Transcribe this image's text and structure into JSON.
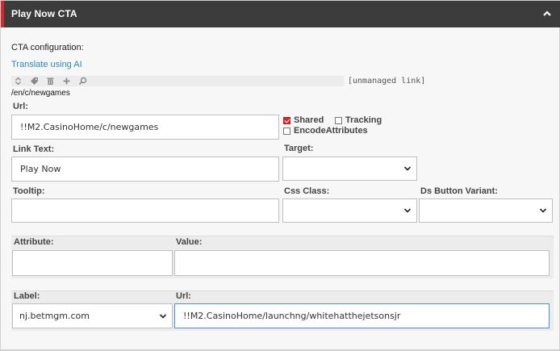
{
  "header": {
    "title": "Play Now CTA",
    "collapse_icon": "chevron-up-icon"
  },
  "cta_configuration_label": "CTA configuration:",
  "translate_link": "Translate using AI",
  "toolbar": {
    "icons": [
      "sort-icon",
      "tag-icon",
      "trash-icon",
      "add-icon",
      "search-icon"
    ],
    "unmanaged_label": "[unmanaged link]",
    "path": "/en/c/newgames"
  },
  "url": {
    "label": "Url:",
    "value": "!!M2.CasinoHome/c/newgames"
  },
  "options": {
    "shared": {
      "label": "Shared",
      "checked": true
    },
    "tracking": {
      "label": "Tracking",
      "checked": false
    },
    "encode_attributes": {
      "label": "EncodeAttributes",
      "checked": false
    }
  },
  "link_text": {
    "label": "Link Text:",
    "value": "Play Now"
  },
  "target": {
    "label": "Target:",
    "value": ""
  },
  "tooltip": {
    "label": "Tooltip:",
    "value": ""
  },
  "css_class": {
    "label": "Css Class:",
    "value": ""
  },
  "ds_button_variant": {
    "label": "Ds Button Variant:",
    "value": ""
  },
  "attributes": {
    "attribute_label": "Attribute:",
    "value_label": "Value:",
    "attribute_value": "",
    "value_value": ""
  },
  "domain_url": {
    "label_label": "Label:",
    "url_label": "Url:",
    "label_value": "nj.betmgm.com",
    "url_value": "!!M2.CasinoHome/launchng/whitehatthejetsonsjr"
  },
  "colors": {
    "header_bg": "#3c3c3c",
    "accent": "#d9272e",
    "link": "#2a8ab7",
    "focus_border": "#4b8fd6"
  }
}
